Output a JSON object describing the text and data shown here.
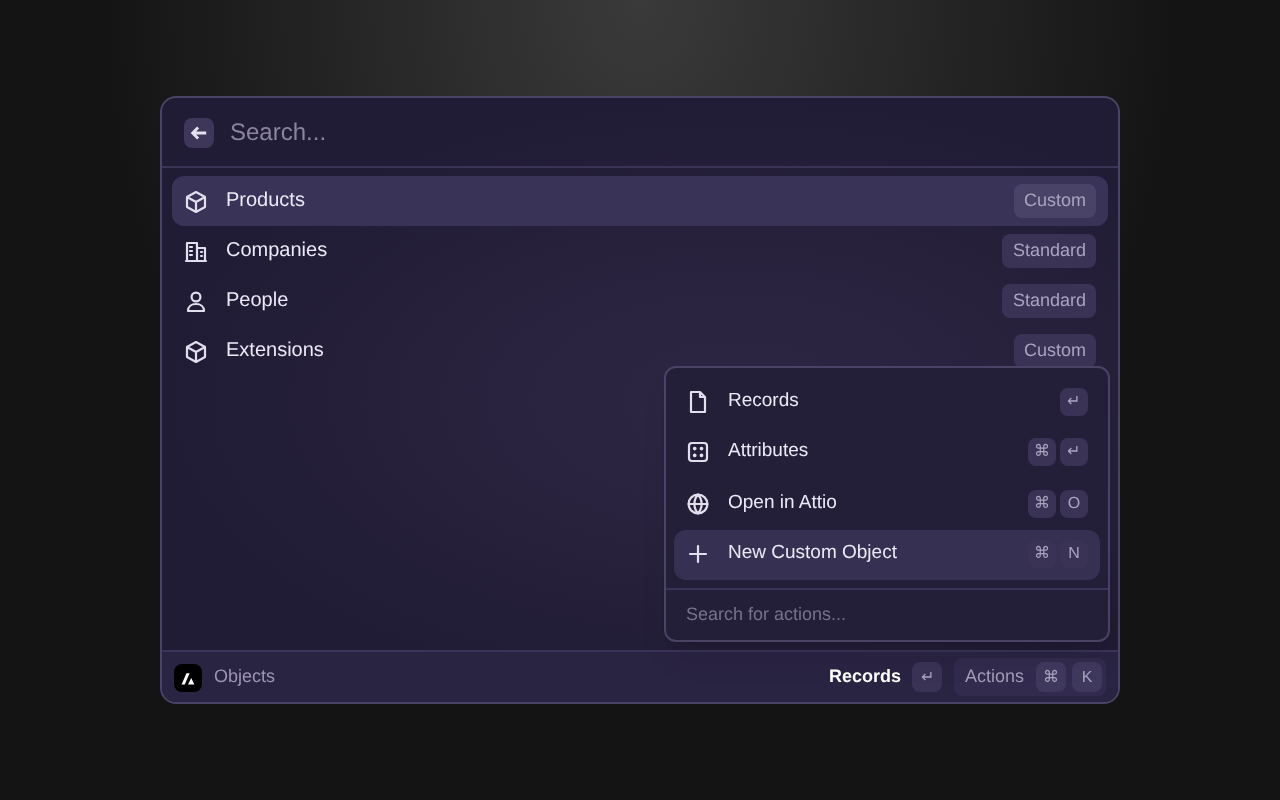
{
  "search": {
    "placeholder": "Search..."
  },
  "objects": [
    {
      "kind": "cube",
      "label": "Products",
      "badge": "Custom",
      "selected": true
    },
    {
      "kind": "building",
      "label": "Companies",
      "badge": "Standard",
      "selected": false
    },
    {
      "kind": "person",
      "label": "People",
      "badge": "Standard",
      "selected": false
    },
    {
      "kind": "cube",
      "label": "Extensions",
      "badge": "Custom",
      "selected": false
    }
  ],
  "actions_menu": {
    "items": [
      {
        "kind": "file",
        "label": "Records",
        "keys": [
          "↵"
        ],
        "selected": false
      },
      {
        "kind": "grid",
        "label": "Attributes",
        "keys": [
          "⌘",
          "↵"
        ],
        "selected": false
      },
      {
        "kind": "globe",
        "label": "Open in Attio",
        "keys": [
          "⌘",
          "O"
        ],
        "selected": false
      },
      {
        "kind": "plus",
        "label": "New Custom Object",
        "keys": [
          "⌘",
          "N"
        ],
        "selected": true
      }
    ],
    "search": {
      "placeholder": "Search for actions..."
    }
  },
  "footer": {
    "context": "Objects",
    "primary": {
      "label": "Records",
      "keys": [
        "↵"
      ]
    },
    "actions": {
      "label": "Actions",
      "keys": [
        "⌘",
        "K"
      ]
    }
  }
}
